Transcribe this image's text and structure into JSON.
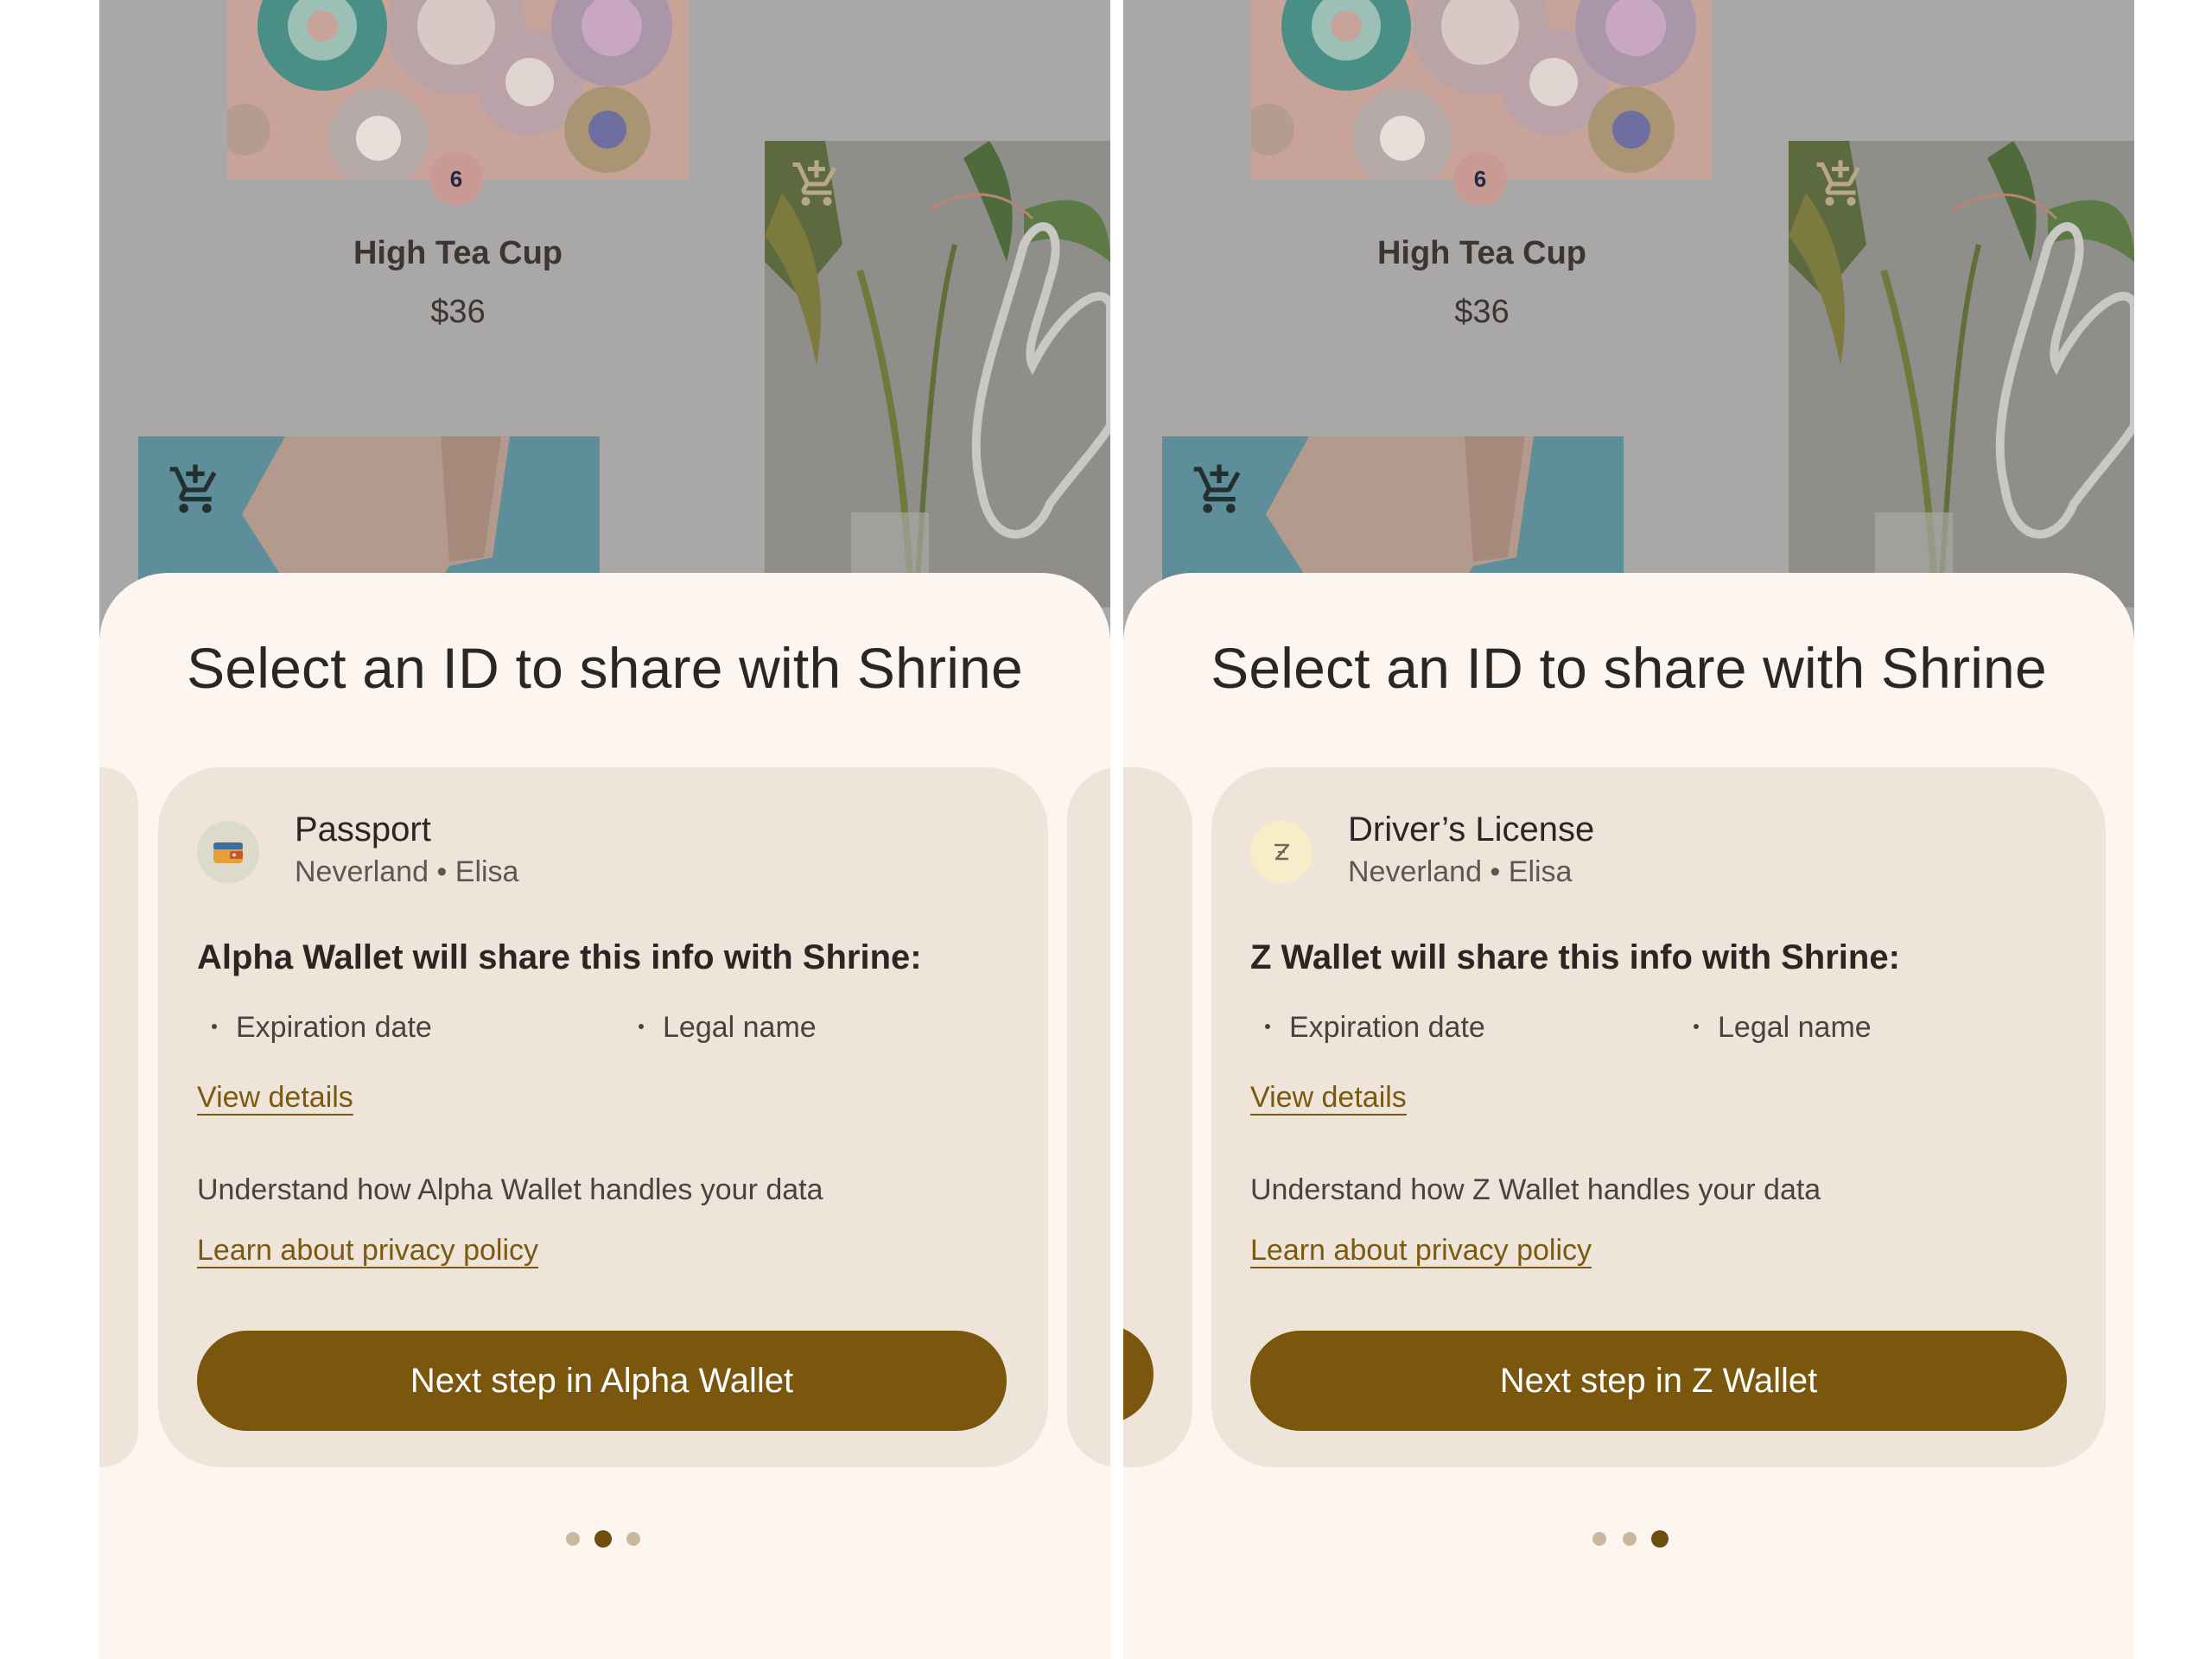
{
  "screens": [
    {
      "product": {
        "badge": "6",
        "name": "High Tea Cup",
        "price": "$36"
      },
      "sheet": {
        "title": "Select an ID to share with Shrine",
        "card": {
          "icon": "wallet-icon",
          "doc_name": "Passport",
          "doc_sub": "Neverland • Elisa",
          "share_heading": "Alpha Wallet will share this info with Shrine:",
          "fields": [
            "Expiration date",
            "Legal name"
          ],
          "view_details": "View details",
          "understand": "Understand how Alpha Wallet handles your data",
          "privacy_link": "Learn about privacy policy",
          "next_button": "Next step in Alpha Wallet"
        },
        "page_count": 3,
        "active_page": 2
      }
    },
    {
      "product": {
        "badge": "6",
        "name": "High Tea Cup",
        "price": "$36"
      },
      "sheet": {
        "title": "Select an ID to share with Shrine",
        "card": {
          "icon": "z-logo-icon",
          "doc_name": "Driver’s License",
          "doc_sub": "Neverland • Elisa",
          "share_heading": "Z Wallet will share this info with Shrine:",
          "fields": [
            "Expiration date",
            "Legal name"
          ],
          "view_details": "View details",
          "understand": "Understand how Z Wallet handles your data",
          "privacy_link": "Learn about privacy policy",
          "next_button": "Next step in Z Wallet"
        },
        "page_count": 3,
        "active_page": 3
      }
    }
  ],
  "colors": {
    "scrim": "#a9a8a7",
    "sheet_bg": "#fdf6f0",
    "card_bg": "#efe4d9",
    "button_bg": "#7a570c",
    "link": "#7a5a10",
    "dot_active": "#6d4e0c",
    "dot_inactive": "#c9b89e"
  }
}
